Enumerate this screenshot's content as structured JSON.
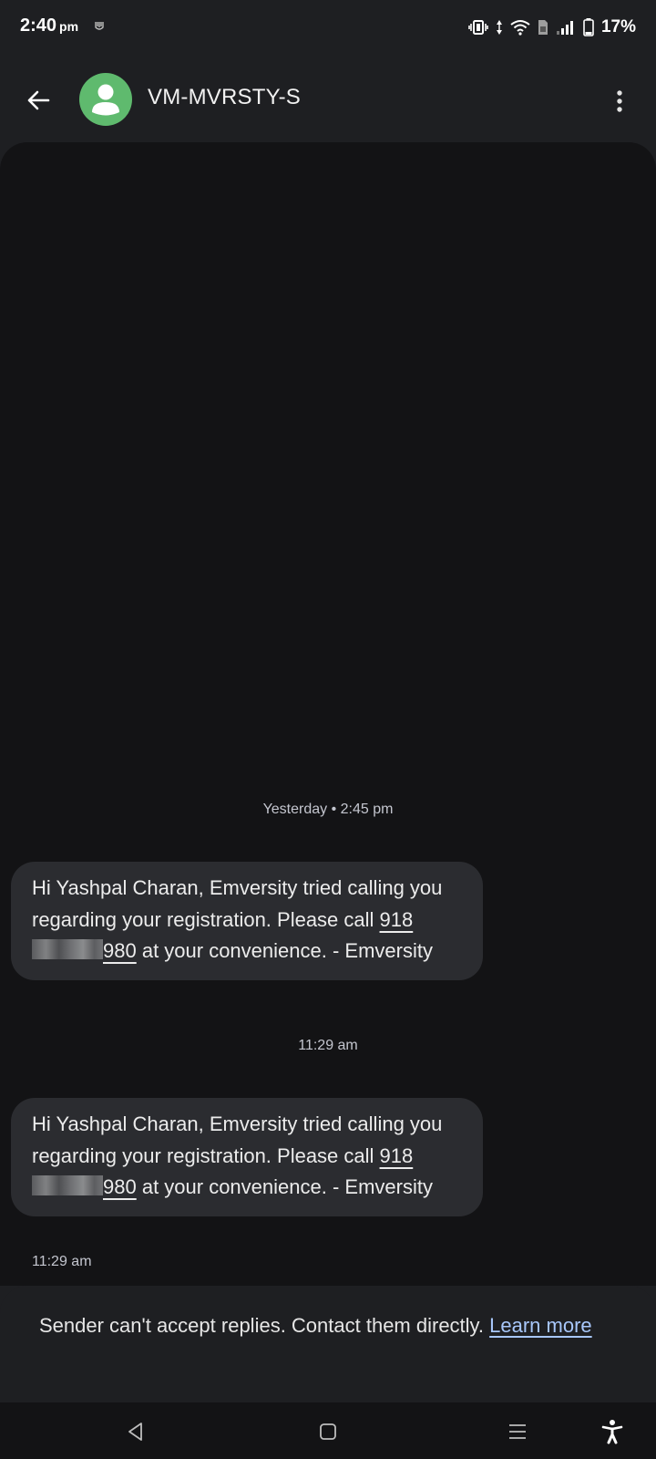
{
  "status_bar": {
    "time": "2:40",
    "ampm": "pm",
    "battery": "17%",
    "icons": [
      "notification-icon",
      "vibrate-icon",
      "data-arrows-icon",
      "wifi-icon",
      "sim-icon",
      "signal-icon",
      "battery-icon"
    ]
  },
  "header": {
    "contact_name": "VM-MVRSTY-S",
    "avatar_icon": "person-icon",
    "avatar_color": "#5fba6e"
  },
  "conversation": {
    "messages": [
      {
        "timestamp_header": "Yesterday • 2:45 pm",
        "text_before": "Hi Yashpal Charan, Emversity tried calling you regarding your registration. Please call ",
        "phone_prefix": "918",
        "phone_suffix": "980",
        "text_after": " at your convenience. - Emversity"
      },
      {
        "timestamp_header": "11:29 am",
        "text_before": "Hi Yashpal Charan, Emversity tried calling you regarding your registration. Please call ",
        "phone_prefix": "918",
        "phone_suffix": "980",
        "text_after": " at your convenience. - Emversity",
        "sent_time": "11:29 am"
      }
    ]
  },
  "notice": {
    "text": "Sender can't accept replies. Contact them directly. ",
    "link_text": "Learn more",
    "link_color": "#a8c7fa"
  },
  "nav_bar": {
    "items": [
      "back-nav-icon",
      "home-nav-icon",
      "recents-nav-icon",
      "accessibility-icon"
    ]
  }
}
